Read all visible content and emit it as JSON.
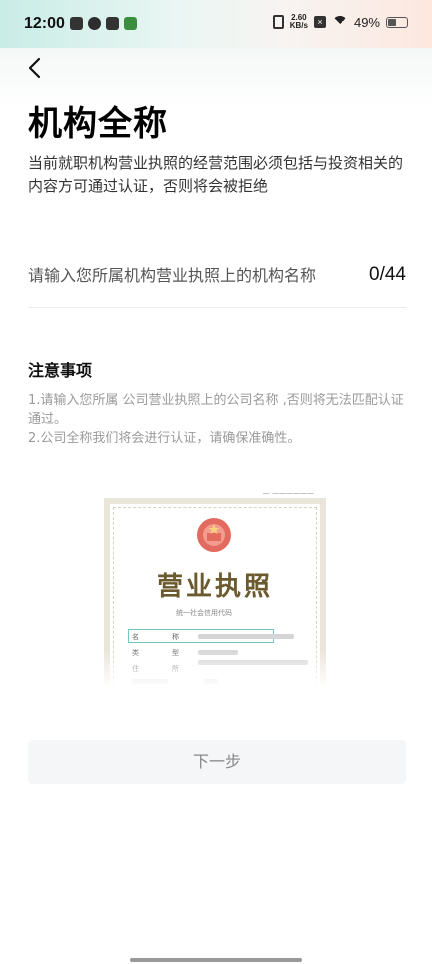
{
  "status_bar": {
    "time": "12:00",
    "network_speed_value": "2.60",
    "network_speed_unit": "KB/s",
    "battery_percent": "49%",
    "battery_level": 0.49,
    "app_icons": [
      "save-icon",
      "weibo-icon",
      "tiktok-icon",
      "game-icon"
    ]
  },
  "header": {
    "back_icon": "chevron-left-icon",
    "title": "机构全称",
    "description": "当前就职机构营业执照的经营范围必须包括与投资相关的内容方可通过认证，否则将会被拒绝"
  },
  "form": {
    "org_name_value": "",
    "org_name_placeholder": "请输入您所属机构营业执照上的机构名称",
    "char_counter": "0/44"
  },
  "notes": {
    "title": "注意事项",
    "items": [
      "1.请输入您所属 公司营业执照上的公司名称 ,否则将无法匹配认证通过。",
      "2.公司全称我们将会进行认证，请确保准确性。"
    ]
  },
  "license_sample": {
    "title": "营业执照",
    "unified_code_label": "统一社会信用代码",
    "field_name_1": "名",
    "field_name_2": "称",
    "field_type_1": "类",
    "field_type_2": "型",
    "field_resident_1": "住",
    "field_resident_2": "所",
    "highlight_color": "#6fc7c0",
    "title_color": "#6b5a2e"
  },
  "actions": {
    "next_label": "下一步"
  }
}
